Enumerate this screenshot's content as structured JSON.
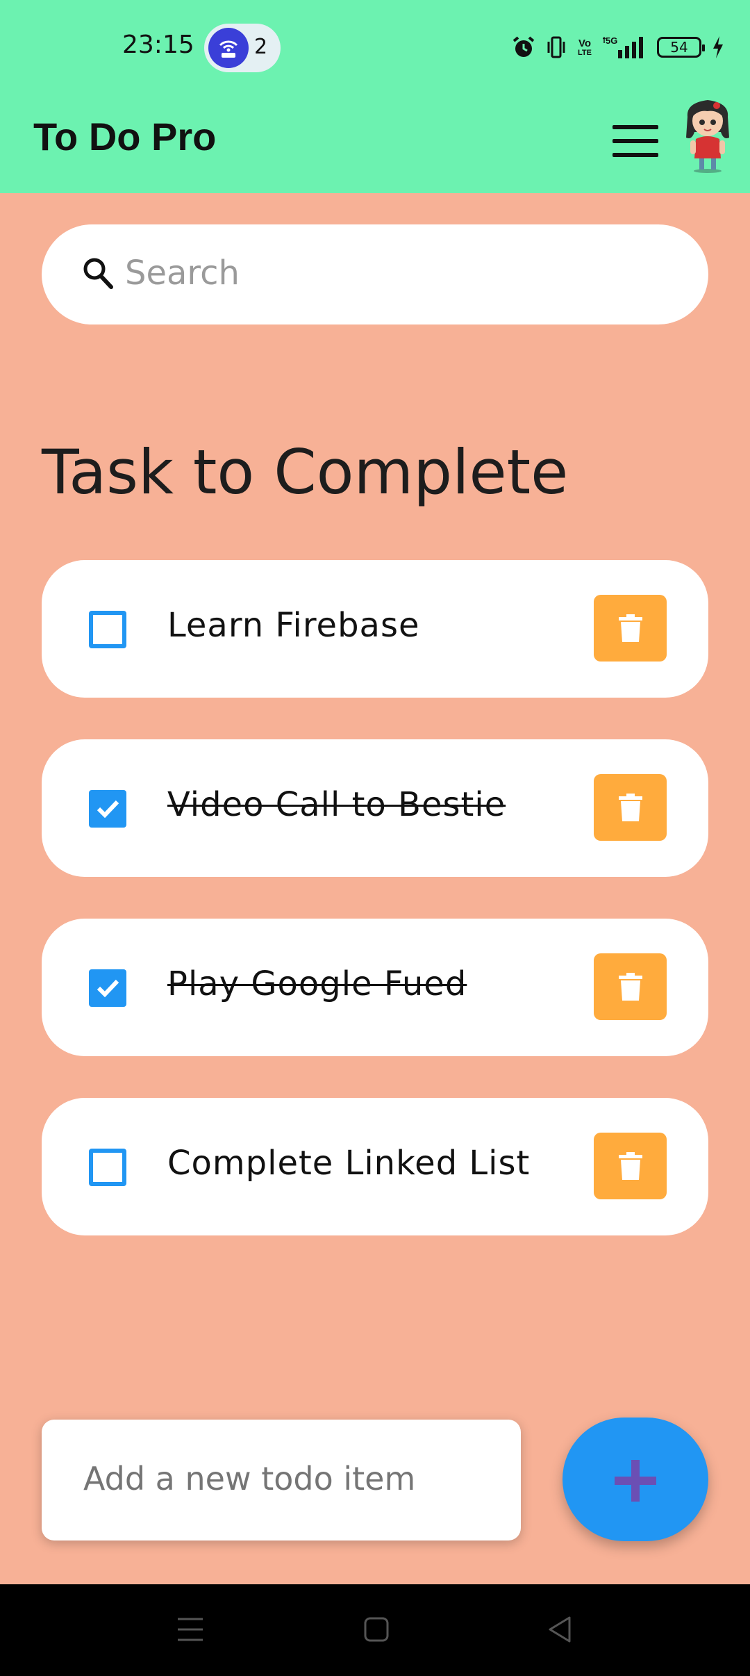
{
  "status_bar": {
    "time": "23:15",
    "hotspot_count": "2",
    "volte_top": "Vo",
    "volte_bottom": "LTE",
    "network": "5G",
    "battery_level": "54"
  },
  "app_bar": {
    "title": "To Do Pro"
  },
  "search": {
    "placeholder": "Search"
  },
  "section": {
    "title": "Task to Complete"
  },
  "todos": [
    {
      "text": "Learn Firebase",
      "done": false
    },
    {
      "text": "Video Call to Bestie",
      "done": true
    },
    {
      "text": "Play Google Fued",
      "done": true
    },
    {
      "text": "Complete Linked List",
      "done": false
    }
  ],
  "add_input": {
    "placeholder": "Add a new todo item"
  },
  "colors": {
    "app_bar_bg": "#6CF2B0",
    "page_bg": "#F7B196",
    "checkbox": "#2196F3",
    "delete_button": "#FFAB3D",
    "fab": "#2196F3",
    "fab_icon": "#6B4FB4"
  }
}
